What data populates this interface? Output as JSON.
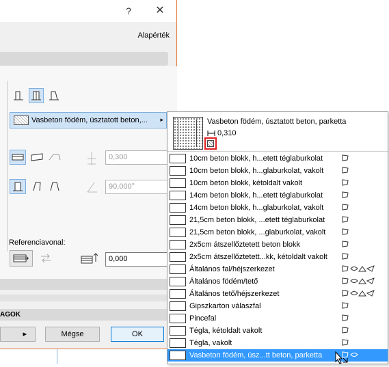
{
  "titlebar": {
    "help_label": "?",
    "close_label": "✕"
  },
  "header": {
    "default_label": "Alapérték"
  },
  "building_material": {
    "selected_label": "Vasbeton födém, úsztatott beton,...",
    "arrow": "▸"
  },
  "fields": {
    "thickness": "0,300",
    "angle": "90,000°",
    "offset": "0,000"
  },
  "reference": {
    "label": "Referenciavonal:"
  },
  "section_label": "AGOK",
  "buttons": {
    "left_arrow": "▸",
    "cancel": "Mégse",
    "ok": "OK"
  },
  "popup": {
    "header_name": "Vasbeton födém, úsztatott beton, parketta",
    "header_thickness": "0,310",
    "items": [
      {
        "label": "10cm beton blokk, h...etett téglaburkolat",
        "swatch": "block",
        "icons": [
          "flag"
        ]
      },
      {
        "label": "10cm beton blokk, h...glaburkolat, vakolt",
        "swatch": "block",
        "icons": [
          "flag"
        ]
      },
      {
        "label": "10cm beton blokk, kétoldalt vakolt",
        "swatch": "cross",
        "icons": [
          "flag"
        ]
      },
      {
        "label": "14cm beton blokk, h...etett téglaburkolat",
        "swatch": "block",
        "icons": [
          "flag"
        ]
      },
      {
        "label": "14cm beton blokk, h...glaburkolat, vakolt",
        "swatch": "block",
        "icons": [
          "flag"
        ]
      },
      {
        "label": "21,5cm beton blokk, ...etett téglaburkolat",
        "swatch": "block",
        "icons": [
          "flag"
        ]
      },
      {
        "label": "21,5cm beton blokk, ...glaburkolat, vakolt",
        "swatch": "block",
        "icons": [
          "flag"
        ]
      },
      {
        "label": "2x5cm átszellőztetett beton blokk",
        "swatch": "block",
        "icons": [
          "flag"
        ]
      },
      {
        "label": "2x5cm átszellőztetett...kk, kétoldalt vakolt",
        "swatch": "block",
        "icons": [
          "flag"
        ]
      },
      {
        "label": "Általános fal/héjszerkezet",
        "swatch": "dark",
        "icons": [
          "flag",
          "eye",
          "roof",
          "send"
        ]
      },
      {
        "label": "Általános födém/tető",
        "swatch": "dark",
        "icons": [
          "flag",
          "eye",
          "roof",
          "send"
        ]
      },
      {
        "label": "Általános tető/héjszerkezet",
        "swatch": "dark",
        "icons": [
          "flag",
          "eye",
          "roof",
          "send"
        ]
      },
      {
        "label": "Gipszkarton válaszfal",
        "swatch": "white",
        "icons": [
          "flag"
        ]
      },
      {
        "label": "Pincefal",
        "swatch": "dots",
        "icons": [
          "flag"
        ]
      },
      {
        "label": "Tégla, kétoldalt vakolt",
        "swatch": "diag",
        "icons": [
          "flag"
        ]
      },
      {
        "label": "Tégla, vakolt",
        "swatch": "diag",
        "icons": [
          "flag"
        ]
      },
      {
        "label": "Vasbeton födém, úsz...tt beton, parketta",
        "swatch": "dots",
        "icons": [
          "flag",
          "eye"
        ],
        "selected": true
      }
    ]
  },
  "colors": {
    "accent": "#3399ff",
    "border_orange": "#e07a3a",
    "highlight": "#e02020"
  }
}
